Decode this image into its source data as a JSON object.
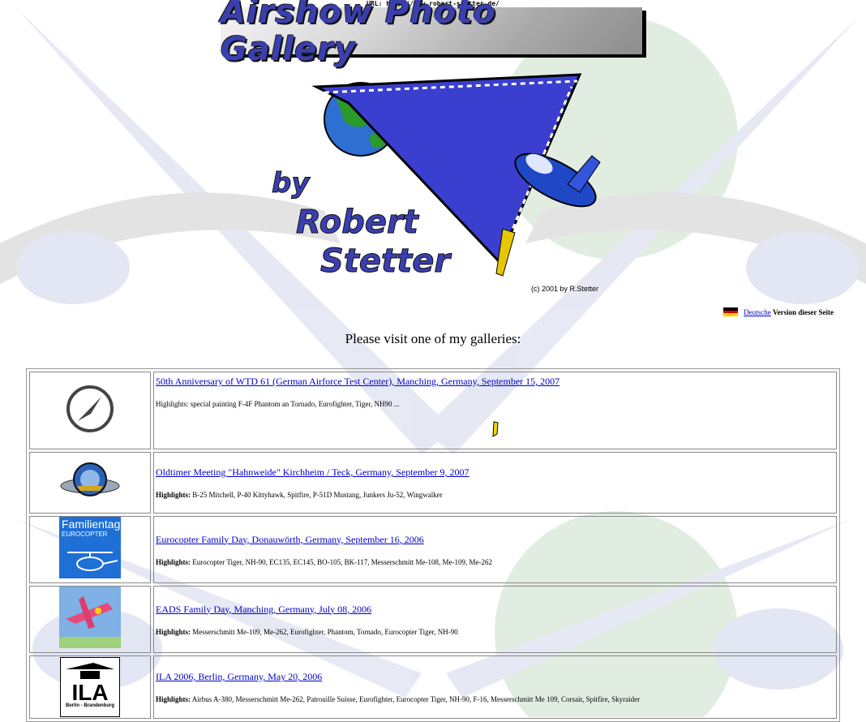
{
  "header": {
    "url_line": "URL: http://www.robert-stetter.de/",
    "banner_title": "Airshow Photo Gallery",
    "hero_text": [
      "by",
      "Robert",
      "Stetter"
    ],
    "copyright": "(c) 2001 by R.Stetter"
  },
  "language": {
    "link_label": "Deutsche",
    "suffix": "Version dieser Seite",
    "flag_colors": [
      "#000000",
      "#dd0000",
      "#ffce00"
    ]
  },
  "invite_text": "Please visit one of my galleries:",
  "galleries": [
    {
      "title": "50th Anniversary of WTD 61 (German Airforce Test Center), Manching, Germany, September 15, 2007",
      "highlight_label": "",
      "highlight_text": "Highlights: special painting F-4F Phantom an Tornado, Eurofighter, Tiger, NH90 ...",
      "thumb_icon": "wtd61-emblem-icon"
    },
    {
      "title": "Oldtimer Meeting \"Hahnweide\" Kirchheim / Teck, Germany, September 9, 2007",
      "highlight_label": "Highlights:",
      "highlight_text": "B-25 Mitchell, P-40 Kittyhawk, Spitfire, P-51D Mustang, Junkers Ju-52, Wingwalker",
      "thumb_icon": "hahnweide-logo-icon"
    },
    {
      "title": "Eurocopter Family Day, Donauwörth, Germany, September 16, 2006",
      "highlight_label": "Highlights:",
      "highlight_text": "Eurocopter Tiger, NH-90, EC135, EC145, BO-105, BK-117, Messerschmitt Me-108, Me-109, Me-262",
      "thumb_icon": "eurocopter-familientag-icon",
      "thumb_text": [
        "Familientag",
        "EUROCOPTER"
      ]
    },
    {
      "title": "EADS Family Day, Manching, Germany, July 08, 2006",
      "highlight_label": "Highlights:",
      "highlight_text": "Messerschmitt Me-109, Me-262, Eurofighter, Phantom, Tornado, Eurocopter Tiger, NH-90",
      "thumb_icon": "eads-family-day-icon"
    },
    {
      "title": "ILA 2006, Berlin, Germany, May 20, 2006",
      "highlight_label": "Highlights:",
      "highlight_text": "Airbus A-380, Messerschmitt Me-262, Patrouille Suisse, Eurofighter, Eurocopter Tiger, NH-90, F-16, Messerschmitt Me 109, Corsair, Spitfire, Skyraider",
      "thumb_icon": "ila-berlin-logo-icon",
      "thumb_text": [
        "ILA",
        "Berlin - Brandenburg"
      ]
    }
  ]
}
